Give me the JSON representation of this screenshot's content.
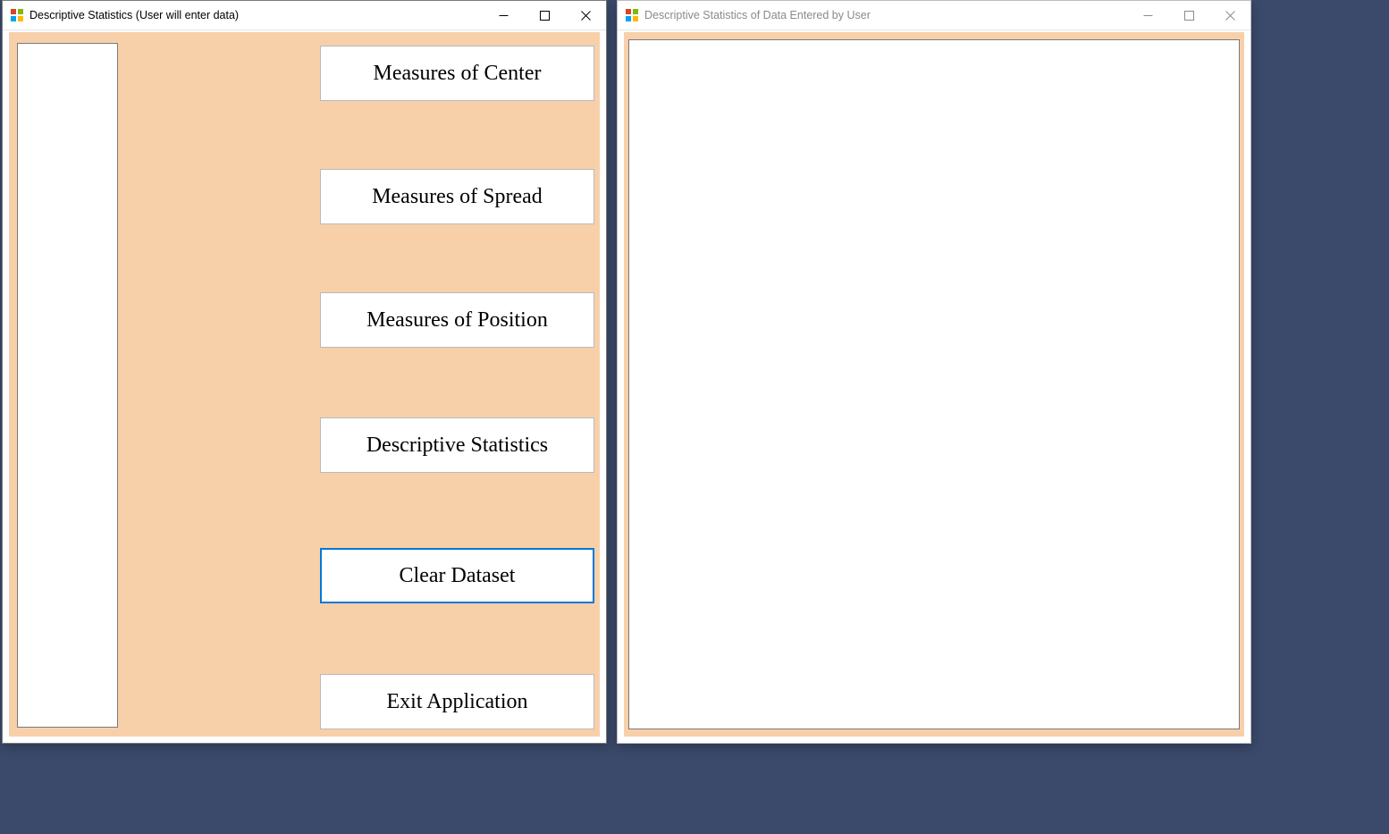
{
  "window1": {
    "title": "Descriptive Statistics (User will enter data)",
    "buttons": {
      "measures_center": "Measures of Center",
      "measures_spread": "Measures of Spread",
      "measures_position": "Measures of Position",
      "descriptive_stats": "Descriptive Statistics",
      "clear_dataset": "Clear Dataset",
      "exit_app": "Exit Application"
    },
    "data_input_value": ""
  },
  "window2": {
    "title": "Descriptive Statistics of Data Entered by User",
    "output_value": ""
  }
}
